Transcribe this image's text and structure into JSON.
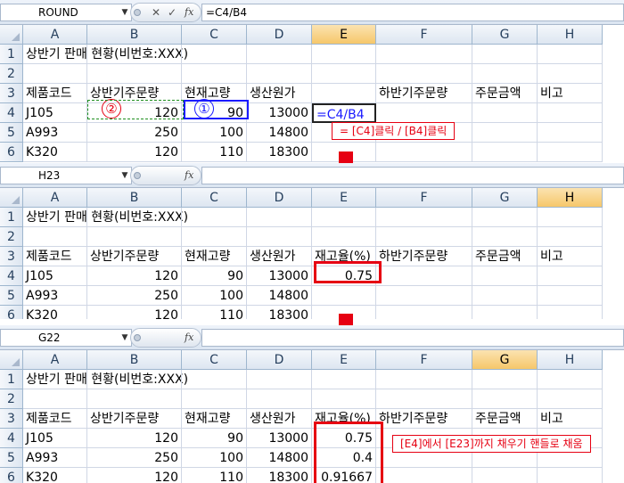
{
  "colors": {
    "red": "#e60012",
    "blue": "#1a1aff",
    "green": "#1f8f1f",
    "selected_header": "#f6c76a"
  },
  "columns": [
    "A",
    "B",
    "C",
    "D",
    "E",
    "F",
    "G",
    "H"
  ],
  "rows": [
    "1",
    "2",
    "3",
    "4",
    "5",
    "6"
  ],
  "panels": [
    {
      "namebox": "ROUND",
      "formula": "=C4/B4",
      "selected_col": "E",
      "cells": {
        "A1": "상반기 판매 현황(비번호:XXX)",
        "A3": "제품코드",
        "B3": "상반기주문량",
        "C3": "현재고량",
        "D3": "생산원가",
        "F3": "하반기주문량",
        "G3": "주문금액",
        "H3": "비고",
        "A4": "J105",
        "B4": "120",
        "C4": "90",
        "D4": "13000",
        "E4": "=C4/B4",
        "A5": "A993",
        "B5": "250",
        "C5": "100",
        "D5": "14800",
        "A6": "K320",
        "B6": "120",
        "C6": "110",
        "D6": "18300"
      },
      "step1": "①",
      "step2": "②",
      "callout": "= [C4]클릭 / [B4]클릭"
    },
    {
      "namebox": "H23",
      "formula": "",
      "selected_col": "H",
      "cells": {
        "A1": "상반기 판매 현황(비번호:XXX)",
        "A3": "제품코드",
        "B3": "상반기주문량",
        "C3": "현재고량",
        "D3": "생산원가",
        "E3": "재고율(%)",
        "F3": "하반기주문량",
        "G3": "주문금액",
        "H3": "비고",
        "A4": "J105",
        "B4": "120",
        "C4": "90",
        "D4": "13000",
        "E4": "0.75",
        "A5": "A993",
        "B5": "250",
        "C5": "100",
        "D5": "14800",
        "A6": "K320",
        "B6": "120",
        "C6": "110",
        "D6": "18300"
      }
    },
    {
      "namebox": "G22",
      "formula": "",
      "selected_col": "G",
      "cells": {
        "A1": "상반기 판매 현황(비번호:XXX)",
        "A3": "제품코드",
        "B3": "상반기주문량",
        "C3": "현재고량",
        "D3": "생산원가",
        "E3": "재고율(%)",
        "F3": "하반기주문량",
        "G3": "주문금액",
        "H3": "비고",
        "A4": "J105",
        "B4": "120",
        "C4": "90",
        "D4": "13000",
        "E4": "0.75",
        "A5": "A993",
        "B5": "250",
        "C5": "100",
        "D5": "14800",
        "E5": "0.4",
        "A6": "K320",
        "B6": "120",
        "C6": "110",
        "D6": "18300",
        "E6": "0.91667"
      },
      "callout": "[E4]에서 [E23]까지 채우기 핸들로 채움"
    }
  ],
  "icons": {
    "cancel": "close-icon",
    "enter": "check-icon",
    "function": "fx-icon",
    "dropdown": "chevron-down-icon",
    "down_arrow": "down-arrow-icon"
  }
}
